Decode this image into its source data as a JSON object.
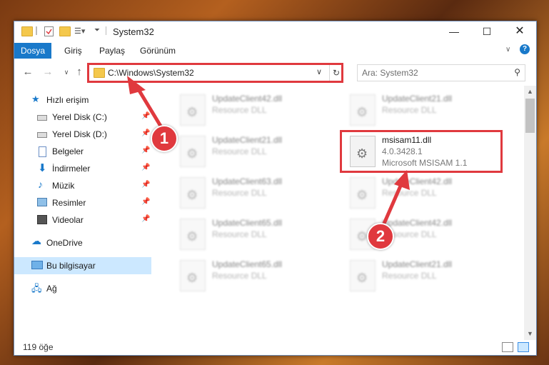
{
  "window": {
    "title": "System32"
  },
  "ribbon": {
    "tabs": [
      "Dosya",
      "Giriş",
      "Paylaş",
      "Görünüm"
    ]
  },
  "address": {
    "path": "C:\\Windows\\System32"
  },
  "search": {
    "placeholder": "Ara: System32"
  },
  "sidebar": {
    "quick_access": "Hızlı erişim",
    "items": [
      {
        "label": "Yerel Disk (C:)"
      },
      {
        "label": "Yerel Disk (D:)"
      },
      {
        "label": "Belgeler"
      },
      {
        "label": "İndirmeler"
      },
      {
        "label": "Müzik"
      },
      {
        "label": "Resimler"
      },
      {
        "label": "Videolar"
      }
    ],
    "onedrive": "OneDrive",
    "this_pc": "Bu bilgisayar",
    "network": "Ağ"
  },
  "files": {
    "left": [
      {
        "name": "UpdateClient42.dll",
        "desc": "Resource DLL"
      },
      {
        "name": "UpdateClient21.dll",
        "desc": "Resource DLL"
      },
      {
        "name": "UpdateClient63.dll",
        "desc": "Resource DLL"
      },
      {
        "name": "UpdateClient65.dll",
        "desc": "Resource DLL"
      },
      {
        "name": "UpdateClient65.dll",
        "desc": "Resource DLL"
      }
    ],
    "right": [
      {
        "name": "UpdateClient21.dll",
        "desc": "Resource DLL"
      },
      {
        "name": "UpdateClient42.dll",
        "desc": "Resource DLL"
      },
      {
        "name": "UpdateClient42.dll",
        "desc": "Resource DLL"
      },
      {
        "name": "UpdateClient21.dll",
        "desc": "Resource DLL"
      }
    ],
    "target": {
      "name": "msisam11.dll",
      "version": "4.0.3428.1",
      "description": "Microsoft MSISAM 1.1"
    }
  },
  "status": {
    "count": "119 öğe"
  },
  "annotations": {
    "step1": "1",
    "step2": "2",
    "color": "#e0393e"
  }
}
